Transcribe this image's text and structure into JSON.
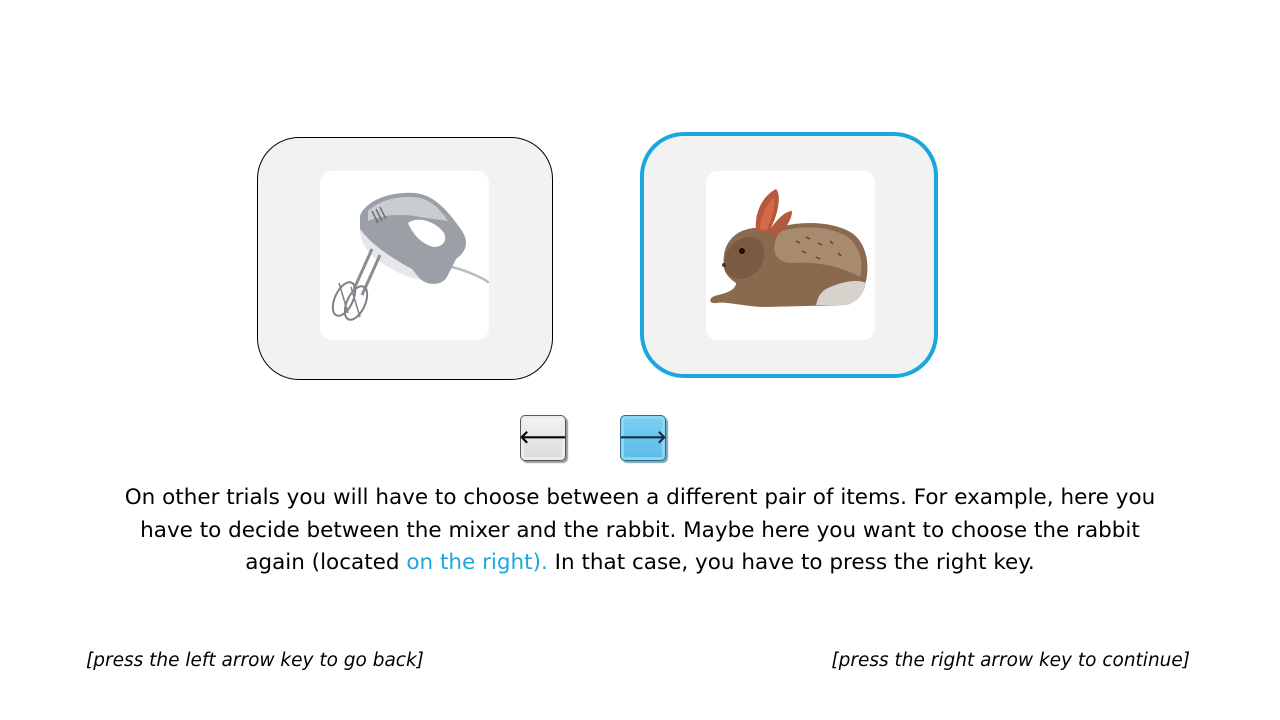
{
  "options": {
    "left": {
      "item": "mixer",
      "icon": "hand-mixer-image"
    },
    "right": {
      "item": "rabbit",
      "icon": "rabbit-image",
      "selected": true,
      "highlight_color": "#1ba6e0"
    }
  },
  "keys": {
    "left": {
      "glyph": "🡐",
      "icon": "left-arrow-icon"
    },
    "right": {
      "glyph": "🡒",
      "icon": "right-arrow-icon",
      "color": "#5bbbe6"
    }
  },
  "instructions": {
    "text_before": "On other trials you will have to choose between a different pair of items. For example, here you have to decide between the mixer and the rabbit.  Maybe here you want to choose the rabbit again (located ",
    "highlight": "on the right).",
    "text_after": " In that case, you have to press the right key."
  },
  "footer": {
    "back": "[press the  left arrow key to go back]",
    "continue": "[press the right arrow key to continue]"
  }
}
